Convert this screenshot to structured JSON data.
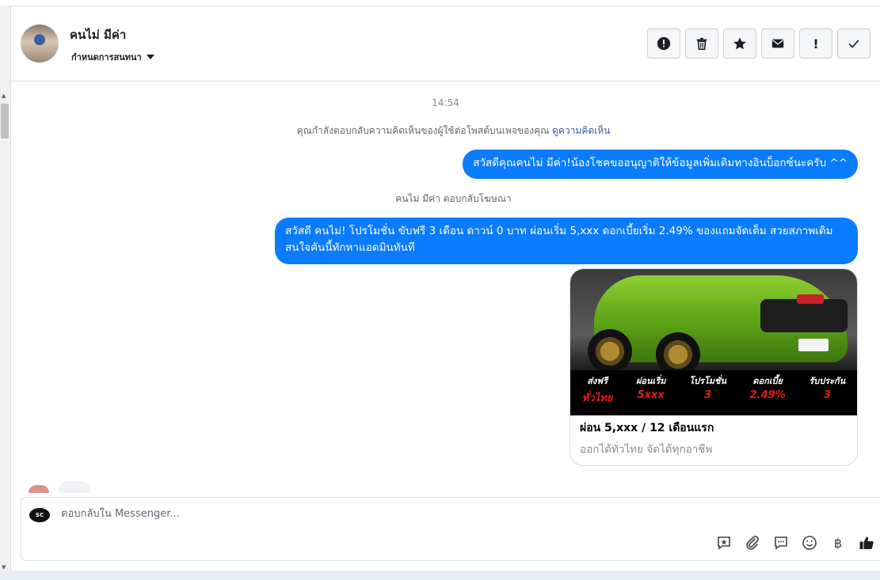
{
  "header": {
    "contact_name": "คนไม่ มีค่า",
    "assign_label": "กำหนดการสนทนา",
    "actions": [
      {
        "name": "report-icon"
      },
      {
        "name": "trash-icon"
      },
      {
        "name": "star-icon"
      },
      {
        "name": "envelope-icon"
      },
      {
        "name": "exclamation-icon",
        "glyph": "!"
      },
      {
        "name": "check-icon"
      }
    ]
  },
  "thread": {
    "timestamp": "14:54",
    "system_notice": "คุณกำลังตอบกลับความคิดเห็นของผู้ใช้ต่อโพสต์บนเพจของคุณ",
    "view_comment_link": "ดูความคิดเห็น",
    "msg1": "สวัสดีคุณคนไม่ มีค่า!น้องโชคขออนุญาติให้ข้อมูลเพิ่มเติมทางอินบ็อกซ์นะครับ ^^",
    "replier_notice": "คนไม่ มีค่า ตอบกลับโฆษณา",
    "msg2": "สวัสดี คนไม่! โปรโมชั่น ขับฟรี 3 เดือน ดาวน์ 0 บาท ผ่อนเริ่ม 5,xxx  ดอกเบี้ยเริ่ม 2.49% ของแถมจัดเต็ม สวยสภาพเดิม สนใจคันนี้ทักหาแอดมินทันที",
    "card": {
      "title": "ผ่อน 5,xxx / 12 เดือนแรก",
      "subtitle": "ออกได้ทั่วไทย จัดได้ทุกอาชีพ",
      "promo": [
        {
          "label": "ส่งฟรี",
          "value": "ทั่วไทย"
        },
        {
          "label": "ผ่อนเริ่ม",
          "value": "5xxx"
        },
        {
          "label": "โปรโมชั่น",
          "value": "3"
        },
        {
          "label": "ดอกเบี้ย",
          "value": "2.49%"
        },
        {
          "label": "รับประกัน",
          "value": "3"
        }
      ]
    }
  },
  "composer": {
    "page_avatar_text": "SC",
    "placeholder": "ตอบกลับใน Messenger..."
  },
  "colors": {
    "accent": "#0a7cff",
    "link": "#385898"
  }
}
